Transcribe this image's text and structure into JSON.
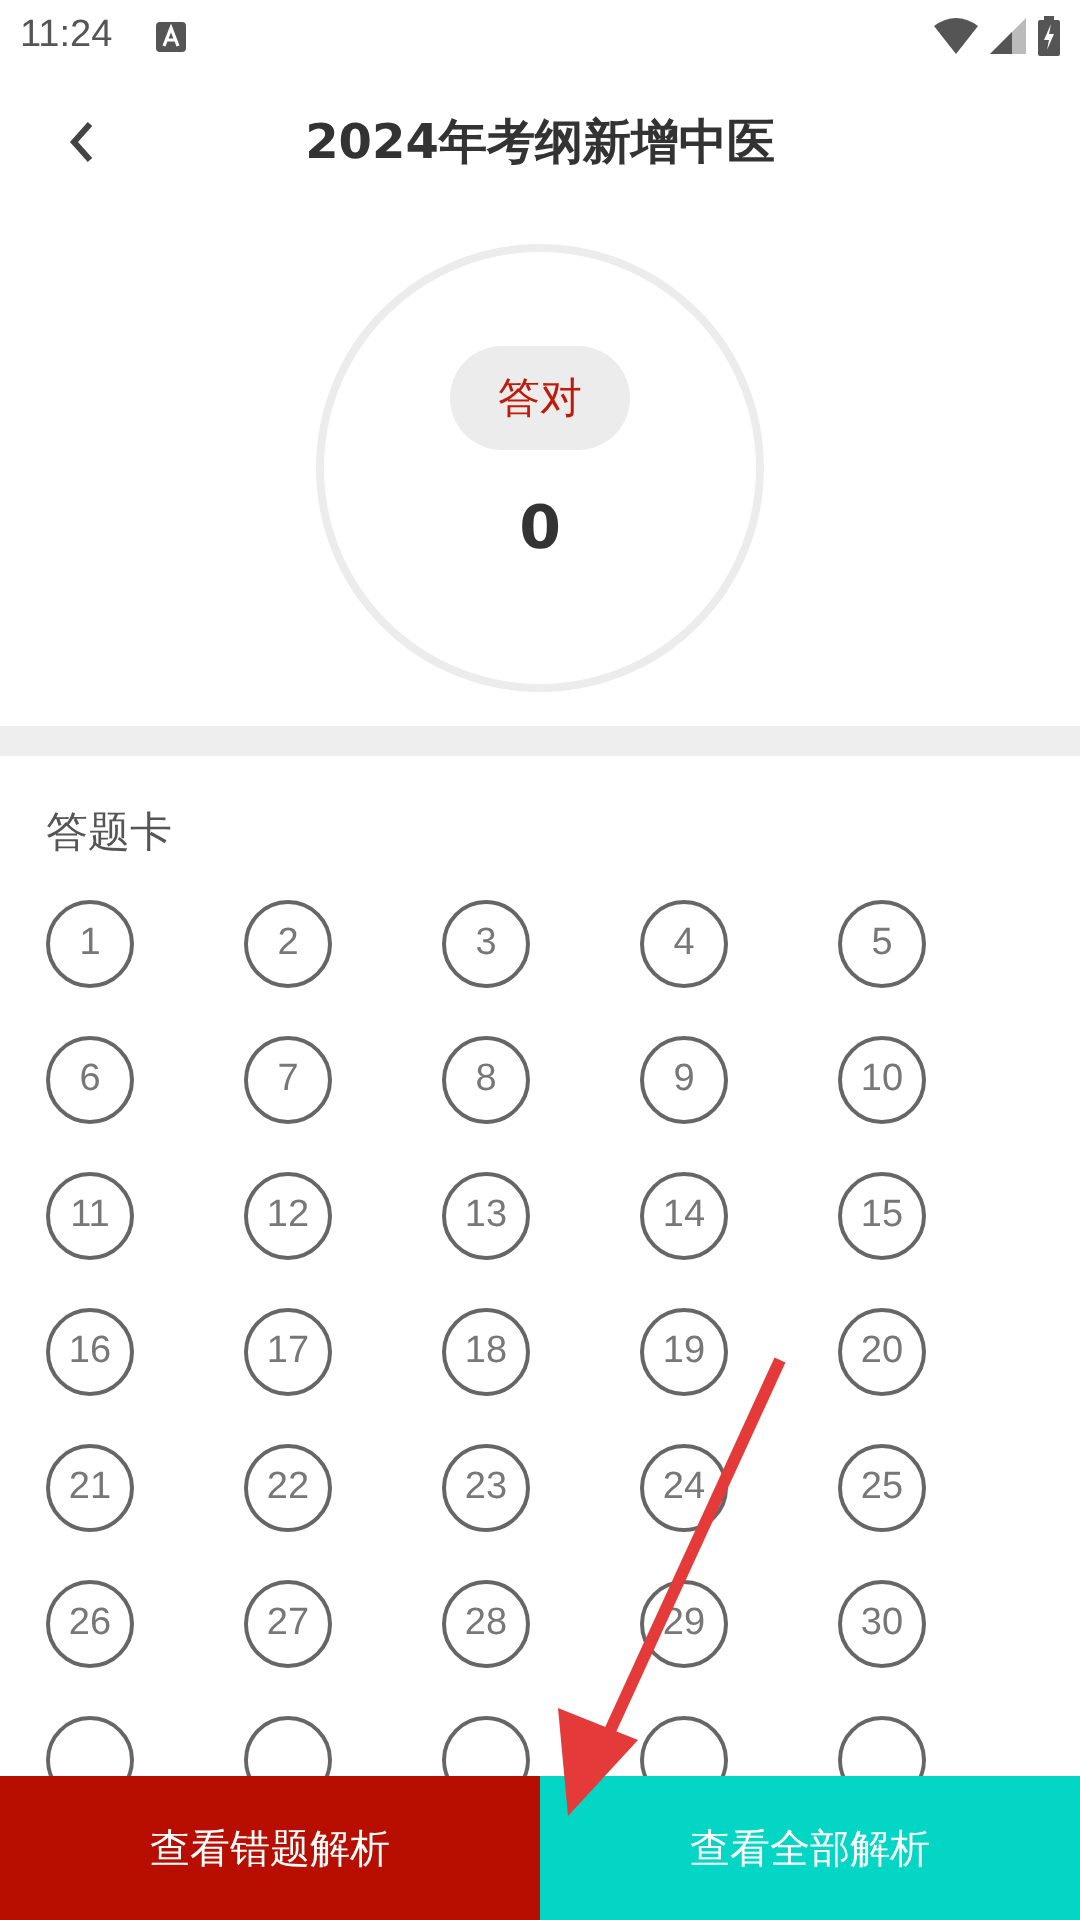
{
  "status_bar": {
    "time": "11:24"
  },
  "header": {
    "title": "2024年考纲新增中医"
  },
  "score": {
    "label": "答对",
    "value": "0"
  },
  "answer_card": {
    "title": "答题卡",
    "items": [
      {
        "kind": "number",
        "label": "1"
      },
      {
        "kind": "number",
        "label": "2"
      },
      {
        "kind": "number",
        "label": "3"
      },
      {
        "kind": "number",
        "label": "4"
      },
      {
        "kind": "number",
        "label": "5"
      },
      {
        "kind": "number",
        "label": "6"
      },
      {
        "kind": "number",
        "label": "7"
      },
      {
        "kind": "number",
        "label": "8"
      },
      {
        "kind": "number",
        "label": "9"
      },
      {
        "kind": "number",
        "label": "10"
      },
      {
        "kind": "number",
        "label": "11"
      },
      {
        "kind": "number",
        "label": "12"
      },
      {
        "kind": "number",
        "label": "13"
      },
      {
        "kind": "number",
        "label": "14"
      },
      {
        "kind": "number",
        "label": "15"
      },
      {
        "kind": "number",
        "label": "16"
      },
      {
        "kind": "number",
        "label": "17"
      },
      {
        "kind": "number",
        "label": "18"
      },
      {
        "kind": "number",
        "label": "19"
      },
      {
        "kind": "number",
        "label": "20"
      },
      {
        "kind": "number",
        "label": "21"
      },
      {
        "kind": "number",
        "label": "22"
      },
      {
        "kind": "number",
        "label": "23"
      },
      {
        "kind": "number",
        "label": "24"
      },
      {
        "kind": "number",
        "label": "25"
      },
      {
        "kind": "number",
        "label": "26"
      },
      {
        "kind": "number",
        "label": "27"
      },
      {
        "kind": "number",
        "label": "28"
      },
      {
        "kind": "number",
        "label": "29"
      },
      {
        "kind": "number",
        "label": "30"
      },
      {
        "kind": "partial"
      },
      {
        "kind": "partial"
      },
      {
        "kind": "partial"
      },
      {
        "kind": "partial"
      },
      {
        "kind": "partial"
      }
    ]
  },
  "bottom_buttons": [
    {
      "label": "查看错题解析",
      "kind": "wrong"
    },
    {
      "label": "查看全部解析",
      "kind": "all"
    }
  ]
}
